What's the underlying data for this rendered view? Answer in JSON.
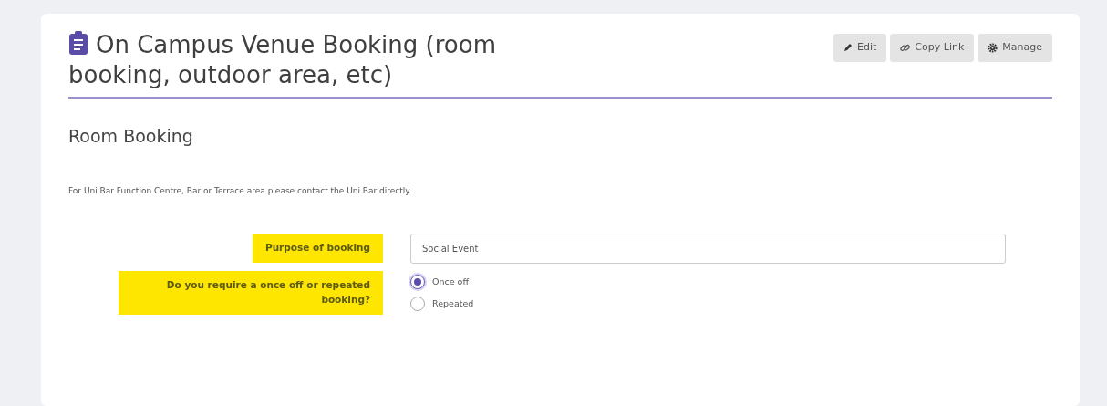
{
  "header": {
    "title": "On Campus Venue Booking (room booking, outdoor area, etc)",
    "buttons": [
      {
        "label": "Edit",
        "kind": "edit"
      },
      {
        "label": "Copy Link",
        "kind": "link"
      },
      {
        "label": "Manage",
        "kind": "manage"
      }
    ]
  },
  "section": {
    "heading": "Room Booking",
    "note": "For Uni Bar Function Centre, Bar or Terrace area please contact the Uni Bar directly."
  },
  "fields": [
    {
      "kind": "text",
      "label": "Purpose of booking",
      "highlighted": true,
      "value": "Social Event"
    },
    {
      "kind": "radio",
      "label": "Do you require a once off or repeated booking?",
      "highlighted": true,
      "options": [
        {
          "label": "Once off",
          "selected": true
        },
        {
          "label": "Repeated",
          "selected": false
        }
      ]
    }
  ]
}
